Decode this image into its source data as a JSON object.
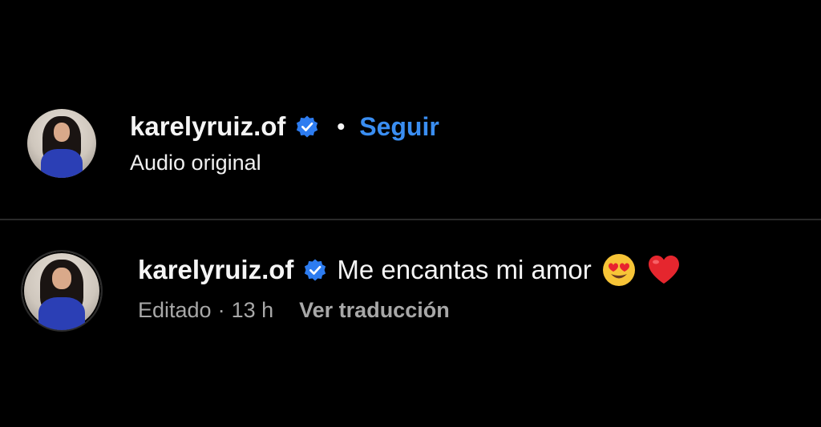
{
  "post": {
    "username": "karelyruiz.of",
    "separator": "•",
    "follow_label": "Seguir",
    "audio_label": "Audio original"
  },
  "comment": {
    "username": "karelyruiz.of",
    "text": "Me encantas mi amor",
    "edited_label": "Editado",
    "meta_separator": "·",
    "time": "13 h",
    "translate_label": "Ver traducción"
  },
  "colors": {
    "background": "#000000",
    "text_primary": "#f5f5f5",
    "text_secondary": "#a8a8a8",
    "link": "#3a8ef2",
    "verified_badge": "#2d7cf0",
    "divider": "#2a2a2a"
  },
  "icons": {
    "verified": "verified-badge-icon",
    "emoji_1": "heart-eyes-emoji-icon",
    "emoji_2": "red-heart-emoji-icon"
  }
}
